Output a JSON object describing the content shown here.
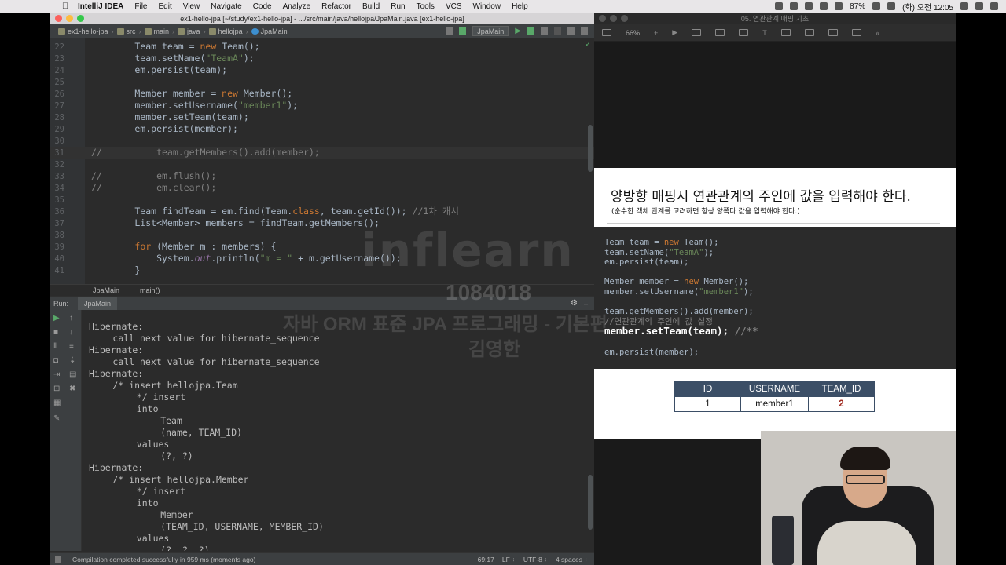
{
  "menubar": {
    "app_name": "IntelliJ IDEA",
    "items": [
      "File",
      "Edit",
      "View",
      "Navigate",
      "Code",
      "Analyze",
      "Refactor",
      "Build",
      "Run",
      "Tools",
      "VCS",
      "Window",
      "Help"
    ],
    "battery": "87%",
    "clock": "(화) 오전 12:05"
  },
  "ide": {
    "window_title": "ex1-hello-jpa [~/study/ex1-hello-jpa] - .../src/main/java/hellojpa/JpaMain.java [ex1-hello-jpa]",
    "breadcrumbs": [
      "ex1-hello-jpa",
      "src",
      "main",
      "java",
      "hellojpa",
      "JpaMain"
    ],
    "run_config": "JpaMain",
    "code_lines": [
      {
        "n": "22",
        "html": "        Team team = <span class=\"kw\">new</span> Team();"
      },
      {
        "n": "23",
        "html": "        team.setName(<span class=\"str\">\"TeamA\"</span>);"
      },
      {
        "n": "24",
        "html": "        em.persist(team);"
      },
      {
        "n": "25",
        "html": ""
      },
      {
        "n": "26",
        "html": "        Member member = <span class=\"kw\">new</span> Member();"
      },
      {
        "n": "27",
        "html": "        member.setUsername(<span class=\"str\">\"member1\"</span>);"
      },
      {
        "n": "28",
        "html": "        member.setTeam(team);"
      },
      {
        "n": "29",
        "html": "        em.persist(member);"
      },
      {
        "n": "30",
        "html": ""
      },
      {
        "n": "31",
        "html": "<span class=\"cmt\">//          team.getMembers().add(member);</span>"
      },
      {
        "n": "32",
        "html": ""
      },
      {
        "n": "33",
        "html": "<span class=\"cmt\">//          em.flush();</span>"
      },
      {
        "n": "34",
        "html": "<span class=\"cmt\">//          em.clear();</span>"
      },
      {
        "n": "35",
        "html": ""
      },
      {
        "n": "36",
        "html": "        Team findTeam = em.find(Team.<span class=\"kw\">class</span>, team.getId()); <span class=\"cmt\">//1차 캐시</span>"
      },
      {
        "n": "37",
        "html": "        List&lt;Member&gt; members = findTeam.getMembers();"
      },
      {
        "n": "38",
        "html": ""
      },
      {
        "n": "39",
        "html": "        <span class=\"kw\">for</span> (Member m : members) {"
      },
      {
        "n": "40",
        "html": "            System.<span class=\"fld\">out</span>.println(<span class=\"str\">\"m = \"</span> + m.getUsername());"
      },
      {
        "n": "41",
        "html": "        }"
      }
    ],
    "editor_breadcrumb": [
      "JpaMain",
      "main()"
    ],
    "run_label": "Run:",
    "run_tab": "JpaMain",
    "console_lines": [
      {
        "indent": 0,
        "text": "Hibernate:"
      },
      {
        "indent": 4,
        "text": "call next value for hibernate_sequence"
      },
      {
        "indent": 0,
        "text": "Hibernate:"
      },
      {
        "indent": 4,
        "text": "call next value for hibernate_sequence"
      },
      {
        "indent": 0,
        "text": "Hibernate:"
      },
      {
        "indent": 4,
        "text": "/* insert hellojpa.Team"
      },
      {
        "indent": 8,
        "text": "*/ insert"
      },
      {
        "indent": 8,
        "text": "into"
      },
      {
        "indent": 12,
        "text": "Team"
      },
      {
        "indent": 12,
        "text": "(name, TEAM_ID)"
      },
      {
        "indent": 8,
        "text": "values"
      },
      {
        "indent": 12,
        "text": "(?, ?)"
      },
      {
        "indent": 0,
        "text": "Hibernate:"
      },
      {
        "indent": 4,
        "text": "/* insert hellojpa.Member"
      },
      {
        "indent": 8,
        "text": "*/ insert"
      },
      {
        "indent": 8,
        "text": "into"
      },
      {
        "indent": 12,
        "text": "Member"
      },
      {
        "indent": 12,
        "text": "(TEAM_ID, USERNAME, MEMBER_ID)"
      },
      {
        "indent": 8,
        "text": "values"
      },
      {
        "indent": 12,
        "text": "(?, ?, ?)"
      }
    ],
    "status_message": "Compilation completed successfully in 959 ms (moments ago)",
    "status_right": [
      "69:17",
      "LF ÷",
      "UTF-8 ÷",
      "4 spaces ÷"
    ]
  },
  "watermark": {
    "logo": "inflearn",
    "number": "1084018",
    "course": "자바 ORM 표준 JPA 프로그래밍 - 기본편",
    "author": "김영한"
  },
  "keynote": {
    "window_title": "05. 연관관계 매핑 기초",
    "zoom": "66%",
    "slide": {
      "title": "양방향 매핑시 연관관계의 주인에 값을 입력해야 한다.",
      "subtitle": "(순수한 객체 관계를 고려하면 항상 양쪽다 값을 입력해야 한다.)",
      "code_lines": [
        {
          "html": "Team team = <span class=\"kw\">new</span> Team();",
          "big": false
        },
        {
          "html": "team.setName(<span class=\"str\">\"TeamA\"</span>);",
          "big": false
        },
        {
          "html": "em.persist(team);",
          "big": false
        },
        {
          "html": "",
          "big": false
        },
        {
          "html": "Member member = <span class=\"kw\">new</span> Member();",
          "big": false
        },
        {
          "html": "member.setUsername(<span class=\"str\">\"member1\"</span>);",
          "big": false
        },
        {
          "html": "",
          "big": false
        },
        {
          "html": "team.getMembers().add(member);",
          "big": false
        },
        {
          "html": "<span class=\"cmt\">//연관관계의 주인에 값 설정</span>",
          "big": false
        },
        {
          "html": "member.setTeam(team); <span class=\"cmt\">//**</span>",
          "big": true
        },
        {
          "html": "",
          "big": false
        },
        {
          "html": "em.persist(member);",
          "big": false
        }
      ],
      "table": {
        "headers": [
          "ID",
          "USERNAME",
          "TEAM_ID"
        ],
        "rows": [
          [
            "1",
            "member1",
            "2"
          ]
        ]
      }
    }
  }
}
